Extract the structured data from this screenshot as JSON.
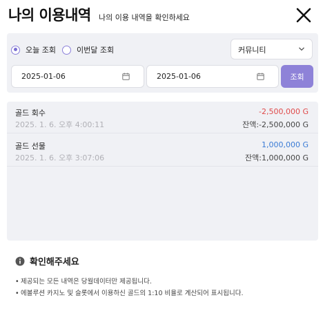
{
  "header": {
    "title": "나의 이용내역",
    "subtitle": "나의 이용 내역을 확인하세요"
  },
  "filters": {
    "radio_today": "오늘 조회",
    "radio_month": "이번달 조회",
    "selected_radio": "today",
    "category_select": "커뮤니티",
    "start_date": "2025-01-06",
    "end_date": "2025-01-06",
    "search_label": "조회"
  },
  "transactions": [
    {
      "name": "골드 회수",
      "datetime": "2025. 1. 6. 오후 4:00:11",
      "amount": "-2,500,000 G",
      "amount_color": "#e04a4a",
      "balance": "잔액:-2,500,000 G"
    },
    {
      "name": "골드 선물",
      "datetime": "2025. 1. 6. 오후 3:07:06",
      "amount": "1,000,000 G",
      "amount_color": "#3a7bd5",
      "balance": "잔액:1,000,000 G"
    }
  ],
  "notice": {
    "title": "확인해주세요",
    "items": [
      "제공되는 모든 내역은 당월데이터만 제공됩니다.",
      "에볼루션 카지노 및 슬롯에서 이용하신 골드의 1:10 비율로 계산되어 표시됩니다."
    ]
  },
  "colors": {
    "accent": "#8e82d8",
    "panel": "#f0f1f5"
  }
}
